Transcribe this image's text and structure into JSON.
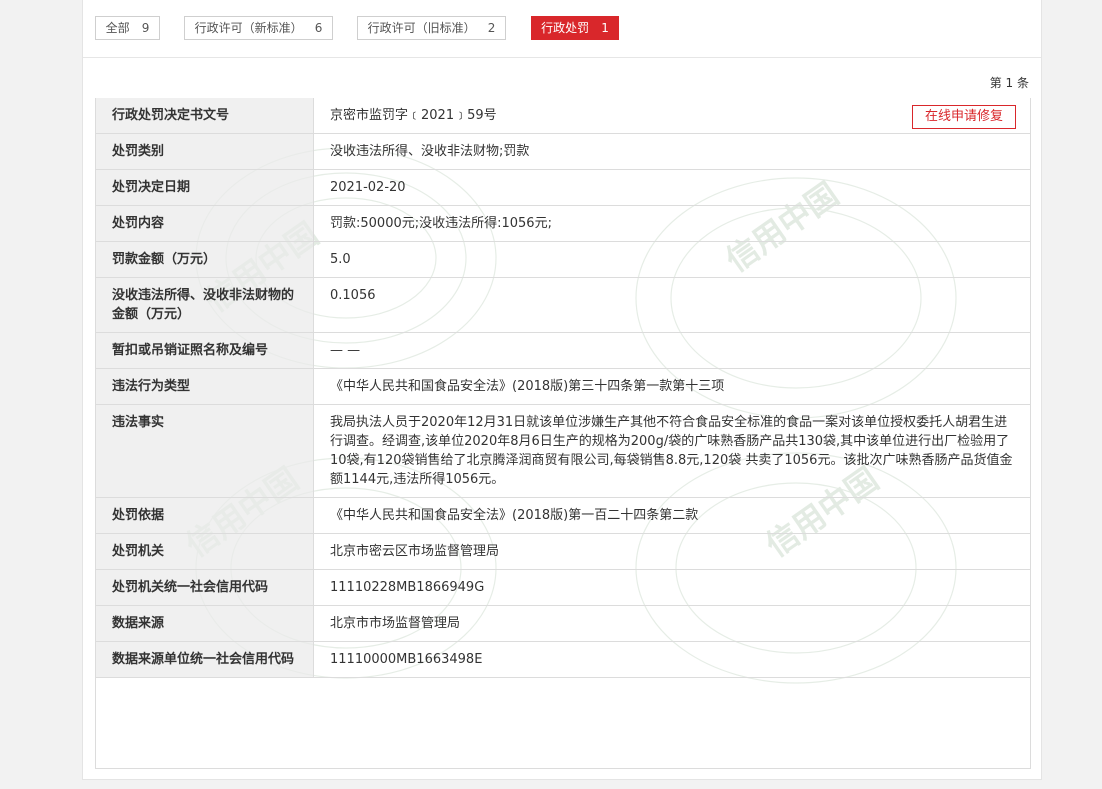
{
  "tabs": [
    {
      "label": "全部",
      "count": "9"
    },
    {
      "label": "行政许可（新标准）",
      "count": "6"
    },
    {
      "label": "行政许可（旧标准）",
      "count": "2"
    },
    {
      "label": "行政处罚",
      "count": "1"
    }
  ],
  "record_count": "第 1 条",
  "fix_button": "在线申请修复",
  "watermark_text": "信用中国",
  "rows": [
    {
      "key": "行政处罚决定书文号",
      "value": "京密市监罚字﹝2021﹞59号"
    },
    {
      "key": "处罚类别",
      "value": "没收违法所得、没收非法财物;罚款"
    },
    {
      "key": "处罚决定日期",
      "value": "2021-02-20"
    },
    {
      "key": "处罚内容",
      "value": "罚款:50000元;没收违法所得:1056元;"
    },
    {
      "key": "罚款金额（万元）",
      "value": "5.0"
    },
    {
      "key": "没收违法所得、没收非法财物的金额（万元）",
      "value": "0.1056"
    },
    {
      "key": "暂扣或吊销证照名称及编号",
      "value": "— —"
    },
    {
      "key": "违法行为类型",
      "value": "《中华人民共和国食品安全法》(2018版)第三十四条第一款第十三项"
    },
    {
      "key": "违法事实",
      "value": "我局执法人员于2020年12月31日就该单位涉嫌生产其他不符合食品安全标准的食品一案对该单位授权委托人胡君生进行调查。经调查,该单位2020年8月6日生产的规格为200g/袋的广味熟香肠产品共130袋,其中该单位进行出厂检验用了10袋,有120袋销售给了北京腾泽润商贸有限公司,每袋销售8.8元,120袋 共卖了1056元。该批次广味熟香肠产品货值金额1144元,违法所得1056元。"
    },
    {
      "key": "处罚依据",
      "value": "《中华人民共和国食品安全法》(2018版)第一百二十四条第二款"
    },
    {
      "key": "处罚机关",
      "value": "北京市密云区市场监督管理局"
    },
    {
      "key": "处罚机关统一社会信用代码",
      "value": "11110228MB1866949G"
    },
    {
      "key": "数据来源",
      "value": "北京市市场监督管理局"
    },
    {
      "key": "数据来源单位统一社会信用代码",
      "value": "11110000MB1663498E"
    }
  ]
}
